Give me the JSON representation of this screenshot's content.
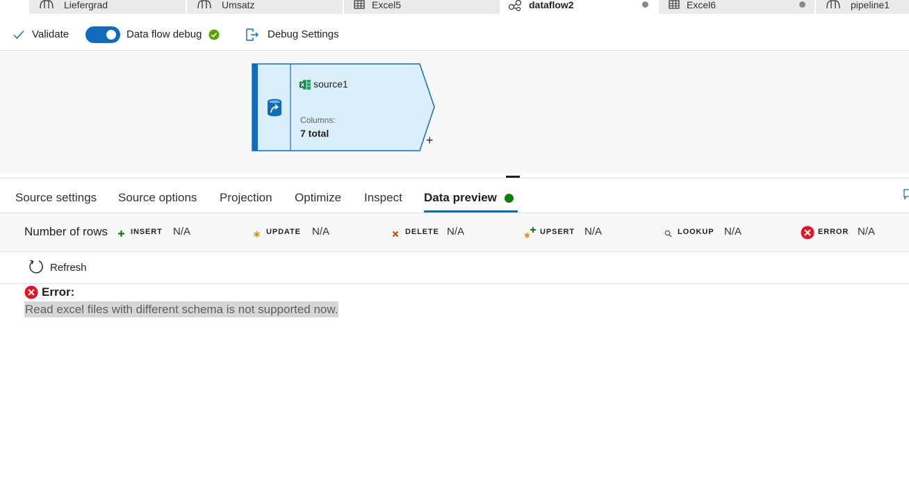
{
  "tabs": [
    {
      "label": "Liefergrad",
      "icon": "pipeline-icon",
      "active": false,
      "dirty": false
    },
    {
      "label": "Umsatz",
      "icon": "pipeline-icon",
      "active": false,
      "dirty": false
    },
    {
      "label": "Excel5",
      "icon": "dataset-icon",
      "active": false,
      "dirty": false
    },
    {
      "label": "dataflow2",
      "icon": "dataflow-icon",
      "active": true,
      "dirty": true
    },
    {
      "label": "Excel6",
      "icon": "dataset-icon",
      "active": false,
      "dirty": true
    },
    {
      "label": "pipeline1",
      "icon": "pipeline-icon",
      "active": false,
      "dirty": false
    }
  ],
  "toolbar": {
    "validate_label": "Validate",
    "debug_label": "Data flow debug",
    "debug_on": true,
    "debug_settings_label": "Debug Settings"
  },
  "node": {
    "name": "source1",
    "columns_label": "Columns:",
    "columns_value": "7 total"
  },
  "panel_tabs": [
    "Source settings",
    "Source options",
    "Projection",
    "Optimize",
    "Inspect",
    "Data preview"
  ],
  "active_panel_tab": "Data preview",
  "stats": {
    "rows_label": "Number of rows",
    "items": [
      {
        "name": "INSERT",
        "value": "N/A",
        "icon": "plus-icon",
        "color": "#107c10"
      },
      {
        "name": "UPDATE",
        "value": "N/A",
        "icon": "asterisk-icon",
        "color": "#d29200"
      },
      {
        "name": "DELETE",
        "value": "N/A",
        "icon": "x-icon",
        "color": "#d83b01"
      },
      {
        "name": "UPSERT",
        "value": "N/A",
        "icon": "upsert-icon",
        "color": "#107c10"
      },
      {
        "name": "LOOKUP",
        "value": "N/A",
        "icon": "magnifier-icon",
        "color": "#605e5c"
      },
      {
        "name": "ERROR",
        "value": "N/A",
        "icon": "error-icon",
        "color": "#e81123"
      }
    ]
  },
  "refresh_label": "Refresh",
  "error": {
    "title": "Error:",
    "message": "Read excel files with different schema is not supported now."
  },
  "colors": {
    "accent": "#0f6cbd",
    "success": "#107c10",
    "error": "#e81123",
    "node_fill": "#dbeefc"
  }
}
